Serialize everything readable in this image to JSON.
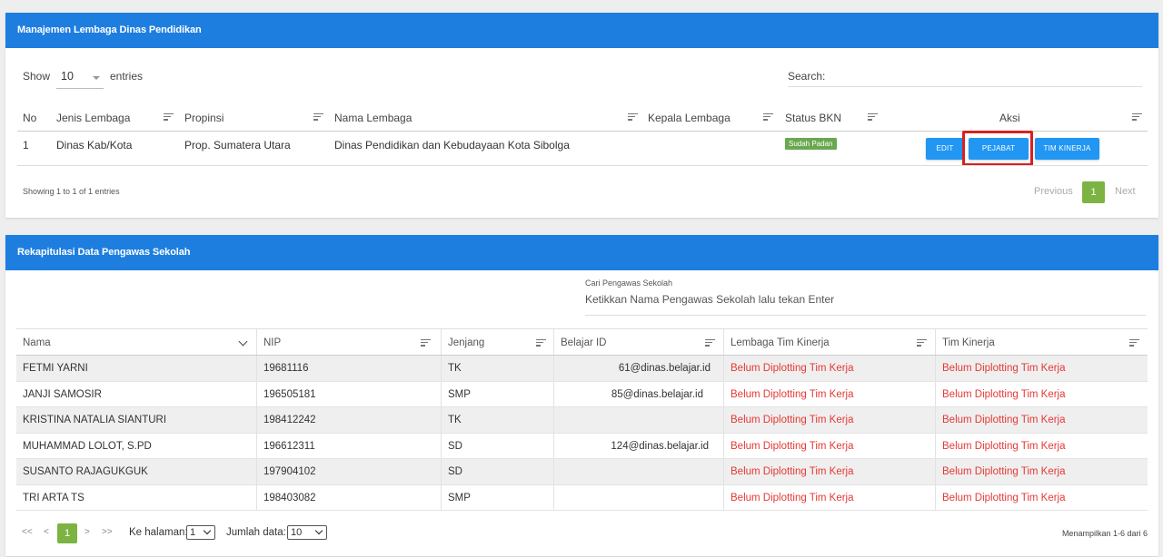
{
  "lembaga": {
    "title": "Manajemen Lembaga Dinas Pendidikan",
    "show_label": "Show",
    "entries_value": "10",
    "entries_label": "entries",
    "search_label": "Search:",
    "columns": [
      "No",
      "Jenis Lembaga",
      "Propinsi",
      "Nama Lembaga",
      "Kepala Lembaga",
      "Status BKN",
      "Aksi"
    ],
    "row": {
      "no": "1",
      "jenis": "Dinas Kab/Kota",
      "propinsi": "Prop. Sumatera Utara",
      "nama": "Dinas Pendidikan dan Kebudayaan Kota Sibolga",
      "kepala": "",
      "status": "Sudah Padan"
    },
    "buttons": {
      "edit": "EDIT",
      "pejabat": "PEJABAT",
      "tim_kinerja": "TIM KINERJA"
    },
    "showing": "Showing 1 to 1 of 1 entries",
    "pagination": {
      "previous": "Previous",
      "current": "1",
      "next": "Next"
    }
  },
  "pengawas": {
    "title": "Rekapitulasi Data Pengawas Sekolah",
    "search_caption": "Cari Pengawas Sekolah",
    "search_placeholder": "Ketikkan Nama Pengawas Sekolah lalu tekan Enter",
    "columns": [
      "Nama",
      "NIP",
      "Jenjang",
      "Belajar ID",
      "Lembaga Tim Kinerja",
      "Tim Kinerja"
    ],
    "rows": [
      {
        "nama": "FETMI YARNI",
        "nip": "19681116",
        "jenjang": "TK",
        "belajar_id": "61@dinas.belajar.id",
        "lembaga": "Belum Diplotting Tim Kerja",
        "tim": "Belum Diplotting Tim Kerja"
      },
      {
        "nama": "JANJI SAMOSIR",
        "nip": "196505181",
        "jenjang": "SMP",
        "belajar_id": "85@dinas.belajar.id",
        "lembaga": "Belum Diplotting Tim Kerja",
        "tim": "Belum Diplotting Tim Kerja"
      },
      {
        "nama": "KRISTINA NATALIA SIANTURI",
        "nip": "198412242",
        "jenjang": "TK",
        "belajar_id": "",
        "lembaga": "Belum Diplotting Tim Kerja",
        "tim": "Belum Diplotting Tim Kerja"
      },
      {
        "nama": "MUHAMMAD LOLOT, S.PD",
        "nip": "196612311",
        "jenjang": "SD",
        "belajar_id": "124@dinas.belajar.id",
        "lembaga": "Belum Diplotting Tim Kerja",
        "tim": "Belum Diplotting Tim Kerja"
      },
      {
        "nama": "SUSANTO RAJAGUKGUK",
        "nip": "197904102",
        "jenjang": "SD",
        "belajar_id": "",
        "lembaga": "Belum Diplotting Tim Kerja",
        "tim": "Belum Diplotting Tim Kerja"
      },
      {
        "nama": "TRI ARTA TS",
        "nip": "198403082",
        "jenjang": "SMP",
        "belajar_id": "",
        "lembaga": "Belum Diplotting Tim Kerja",
        "tim": "Belum Diplotting Tim Kerja"
      }
    ],
    "footer": {
      "first": "<<",
      "prev": "<",
      "current": "1",
      "next": ">",
      "last": ">>",
      "halaman_label": "Ke halaman:",
      "halaman_value": "1",
      "jumlah_label": "Jumlah data:",
      "jumlah_value": "10",
      "info": "Menampilkan 1-6 dari 6"
    }
  },
  "colors": {
    "header_blue": "#1e7ee0",
    "button_blue": "#2196f3",
    "badge_green": "#6aa84f",
    "page_green": "#7cb342",
    "highlight_red": "#d9201f",
    "text_red": "#e53935"
  }
}
